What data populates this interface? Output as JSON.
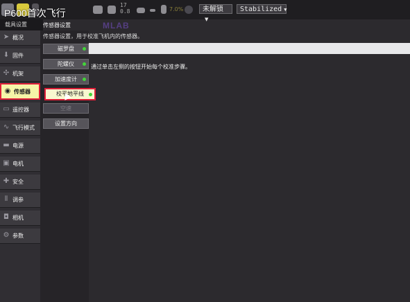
{
  "app": {
    "title": "P600首次飞行"
  },
  "toolbar": {
    "signal_values": [
      "17",
      "0.8"
    ],
    "battery_value": "7.0%",
    "unlock_select": "未解锁",
    "mode_select": "Stabilized"
  },
  "settings_label": "载具设置",
  "watermark": "MLAB",
  "sidebar": {
    "items": [
      {
        "label": "概况",
        "icon": "paper-plane-icon"
      },
      {
        "label": "固件",
        "icon": "download-icon"
      },
      {
        "label": "机架",
        "icon": "airframe-icon"
      },
      {
        "label": "传感器",
        "icon": "radio-waves-icon"
      },
      {
        "label": "遥控器",
        "icon": "remote-control-icon"
      },
      {
        "label": "飞行模式",
        "icon": "wave-icon"
      },
      {
        "label": "电源",
        "icon": "power-icon"
      },
      {
        "label": "电机",
        "icon": "motor-icon"
      },
      {
        "label": "安全",
        "icon": "safety-icon"
      },
      {
        "label": "调参",
        "icon": "sliders-icon"
      },
      {
        "label": "相机",
        "icon": "camera-icon"
      },
      {
        "label": "参数",
        "icon": "gears-icon"
      }
    ]
  },
  "sensors": {
    "title": "传感器设置",
    "description": "传感器设置，用于校准飞机内的传感器。",
    "buttons": [
      {
        "label": "磁罗盘",
        "status": "ok"
      },
      {
        "label": "陀螺仪",
        "status": "ok"
      },
      {
        "label": "加速度计",
        "status": "ok"
      },
      {
        "label": "校平地平线",
        "status": "ok"
      },
      {
        "label": "空速",
        "status": "disabled"
      },
      {
        "label": "设置方向",
        "status": "none"
      }
    ]
  },
  "main": {
    "instruction": "通过单击左侧的按钮开始每个校准步骤。"
  }
}
